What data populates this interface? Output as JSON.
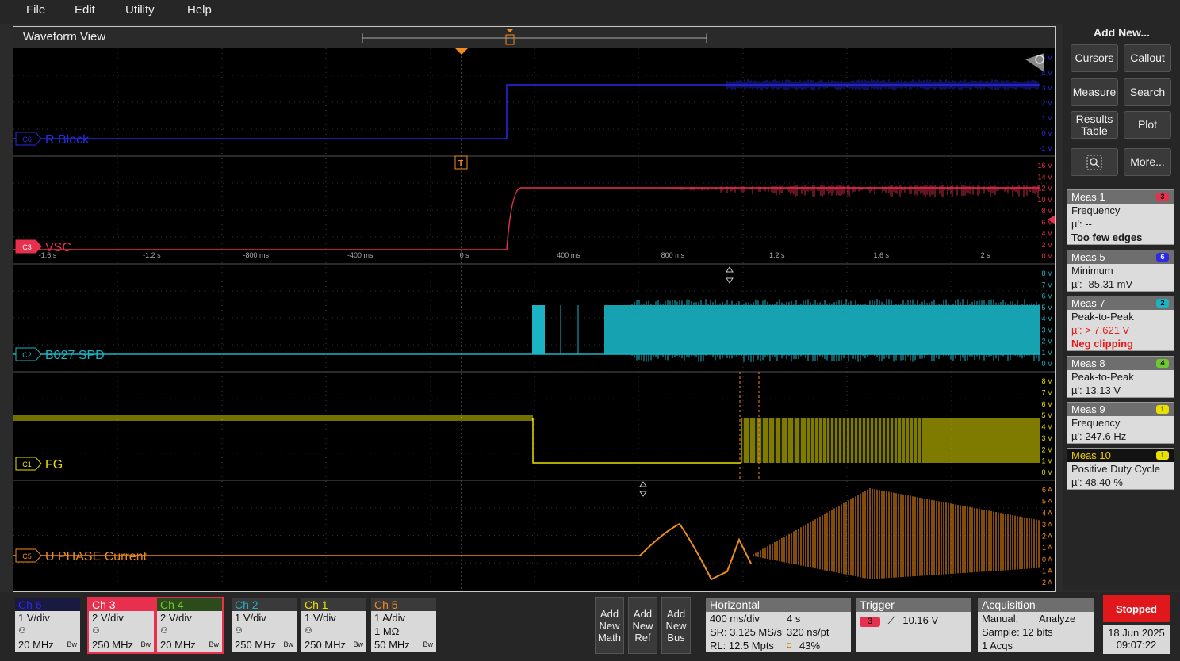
{
  "menu": {
    "file": "File",
    "edit": "Edit",
    "utility": "Utility",
    "help": "Help"
  },
  "waveform_view": {
    "title": "Waveform View",
    "time_labels": [
      "-1.6 s",
      "-1.2 s",
      "-800 ms",
      "-400 ms",
      "0 s",
      "400 ms",
      "800 ms",
      "1.2 s",
      "1.6 s",
      "2 s"
    ],
    "trigger_marker": "T",
    "channels": [
      {
        "id": "C6",
        "label": "R Block",
        "color": "#2a2ae8",
        "scale": [
          "5 V",
          "4 V",
          "3 V",
          "2 V",
          "1 V",
          "0 V",
          "-1 V"
        ]
      },
      {
        "id": "C3",
        "label": "VSC",
        "color": "#e8304e",
        "scale": [
          "16 V",
          "14 V",
          "12 V",
          "10 V",
          "8 V",
          "6 V",
          "4 V",
          "2 V",
          "0 V"
        ]
      },
      {
        "id": "C2",
        "label": "B027 SPD",
        "color": "#1ab4c4",
        "scale": [
          "8 V",
          "7 V",
          "6 V",
          "5 V",
          "4 V",
          "3 V",
          "2 V",
          "1 V",
          "0 V"
        ]
      },
      {
        "id": "C1",
        "label": "FG",
        "color": "#e8e000",
        "scale": [
          "8 V",
          "7 V",
          "6 V",
          "5 V",
          "4 V",
          "3 V",
          "2 V",
          "1 V",
          "0 V"
        ]
      },
      {
        "id": "C5",
        "label": "U PHASE Current",
        "color": "#f08c1c",
        "scale": [
          "6 A",
          "5 A",
          "4 A",
          "3 A",
          "2 A",
          "1 A",
          "0 A",
          "-1 A",
          "-2 A"
        ]
      }
    ]
  },
  "right_panel": {
    "add_new": "Add New...",
    "buttons": {
      "cursors": "Cursors",
      "callout": "Callout",
      "measure": "Measure",
      "search": "Search",
      "results_table_1": "Results",
      "results_table_2": "Table",
      "plot": "Plot",
      "more": "More..."
    },
    "measurements": [
      {
        "name": "Meas 1",
        "badge": "3",
        "badge_color": "#e8304e",
        "lines": [
          "Frequency",
          "µ': --"
        ],
        "warn": "Too few edges"
      },
      {
        "name": "Meas 5",
        "badge": "6",
        "badge_color": "#2a2ae8",
        "lines": [
          "Minimum",
          "µ': -85.31 mV"
        ]
      },
      {
        "name": "Meas 7",
        "badge": "2",
        "badge_color": "#1ab4c4",
        "lines": [
          "Peak-to-Peak"
        ],
        "red_lines": [
          "µ': > 7.621 V",
          "Neg clipping"
        ]
      },
      {
        "name": "Meas 8",
        "badge": "4",
        "badge_color": "#6ec832",
        "lines": [
          "Peak-to-Peak",
          "µ': 13.13 V"
        ]
      },
      {
        "name": "Meas 9",
        "badge": "1",
        "badge_color": "#e8e000",
        "lines": [
          "Frequency",
          "µ': 247.6 Hz"
        ]
      },
      {
        "name": "Meas 10",
        "badge": "1",
        "badge_color": "#e8e000",
        "lines": [
          "Positive Duty Cycle",
          "µ': 48.40 %"
        ]
      }
    ]
  },
  "channel_boxes": [
    {
      "name": "Ch 6",
      "vdiv": "1 V/div",
      "bw": "20 MHz",
      "color": "#2a2ae8"
    },
    {
      "name": "Ch 3",
      "vdiv": "2 V/div",
      "bw": "250 MHz",
      "color": "#e8304e"
    },
    {
      "name": "Ch 4",
      "vdiv": "2 V/div",
      "bw": "20 MHz",
      "color": "#6ec832"
    },
    {
      "name": "Ch 2",
      "vdiv": "1 V/div",
      "bw": "250 MHz",
      "color": "#1ab4c4"
    },
    {
      "name": "Ch 1",
      "vdiv": "1 V/div",
      "bw": "250 MHz",
      "color": "#e8e000"
    },
    {
      "name": "Ch 5",
      "vdiv": "1 A/div",
      "extra": "1 MΩ",
      "bw": "50 MHz",
      "color": "#f08c1c"
    }
  ],
  "bw_symbol": "Bw",
  "add_new_math": [
    "Add",
    "New",
    "Math"
  ],
  "add_new_ref": [
    "Add",
    "New",
    "Ref"
  ],
  "add_new_bus": [
    "Add",
    "New",
    "Bus"
  ],
  "horizontal": {
    "title": "Horizontal",
    "scale": "400 ms/div",
    "duration": "4 s",
    "sr": "SR: 3.125 MS/s",
    "pt": "320 ns/pt",
    "rl": "RL: 12.5 Mpts",
    "pos": "43%"
  },
  "trigger": {
    "title": "Trigger",
    "source": "3",
    "level": "10.16 V"
  },
  "acquisition": {
    "title": "Acquisition",
    "mode": "Manual,",
    "analyze": "Analyze",
    "sample": "Sample: 12 bits",
    "acqs": "1 Acqs"
  },
  "status": {
    "state": "Stopped",
    "date": "18 Jun 2025",
    "time": "09:07:22"
  }
}
